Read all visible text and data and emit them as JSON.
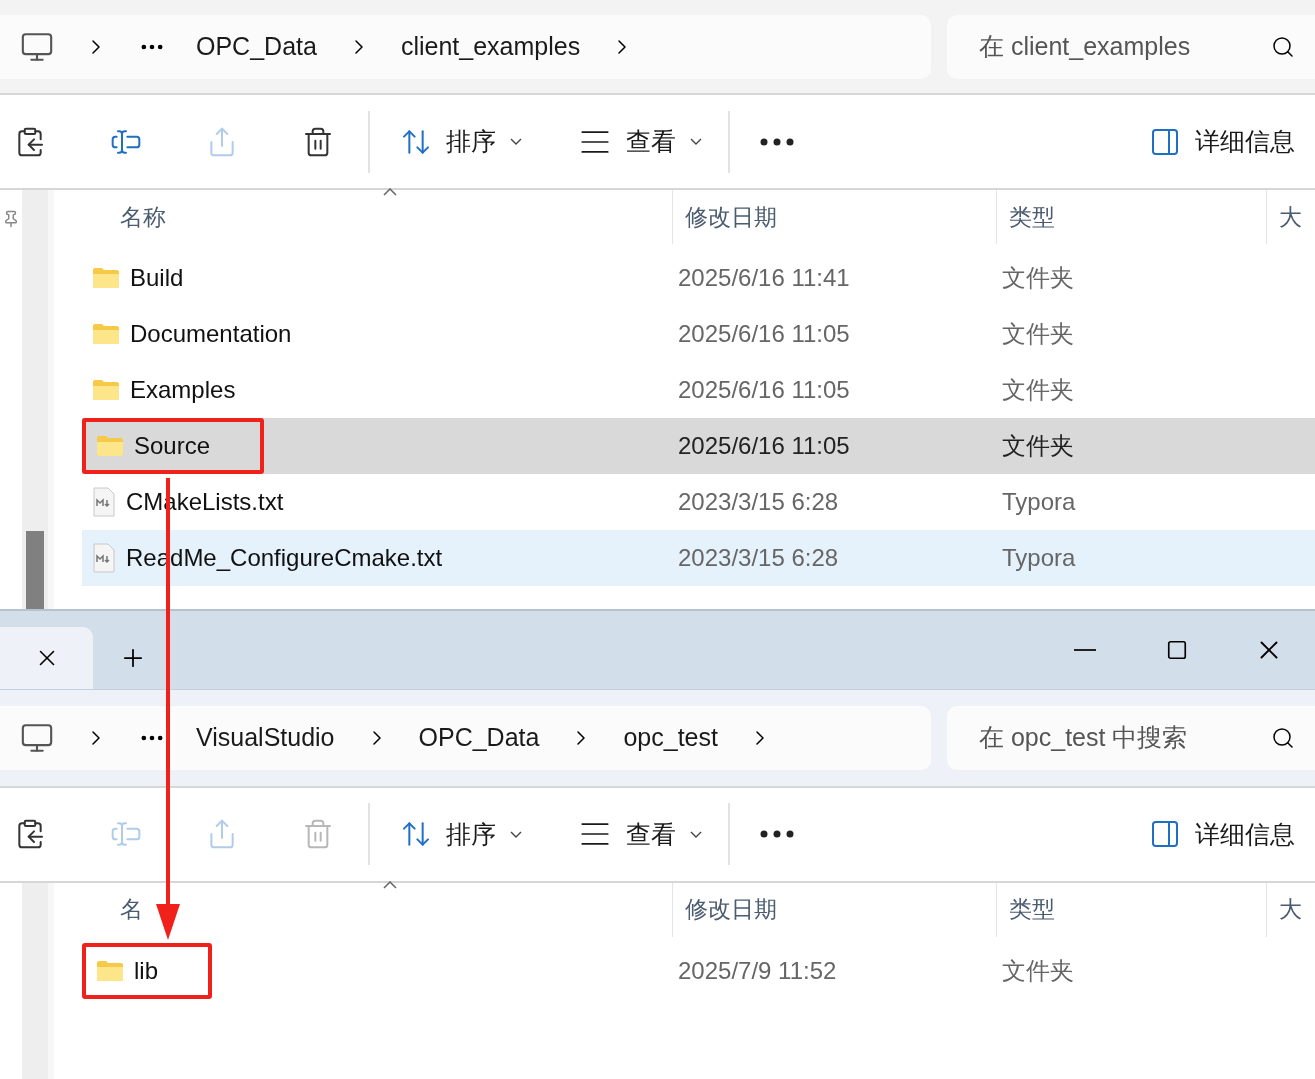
{
  "windows": [
    {
      "kind": "plain",
      "breadcrumb": [
        "OPC_Data",
        "client_examples"
      ],
      "search": {
        "placeholder": "在 client_examples"
      },
      "toolbar": {
        "actions": [
          {
            "kind": "copy",
            "disabled": false
          },
          {
            "kind": "rename",
            "disabled": false
          },
          {
            "kind": "share",
            "disabled": true
          },
          {
            "kind": "delete",
            "disabled": false
          }
        ],
        "sort": "排序",
        "view": "查看",
        "details": "详细信息"
      },
      "columns": [
        "名称",
        "修改日期",
        "类型",
        "大"
      ],
      "rows": [
        {
          "kind": "folder",
          "name": "Build",
          "date": "2025/6/16 11:41",
          "type": "文件夹",
          "selected": false,
          "hovered": false,
          "marked": false
        },
        {
          "kind": "folder",
          "name": "Documentation",
          "date": "2025/6/16 11:05",
          "type": "文件夹",
          "selected": false,
          "hovered": false,
          "marked": false
        },
        {
          "kind": "folder",
          "name": "Examples",
          "date": "2025/6/16 11:05",
          "type": "文件夹",
          "selected": false,
          "hovered": false,
          "marked": false
        },
        {
          "kind": "folder",
          "name": "Source",
          "date": "2025/6/16 11:05",
          "type": "文件夹",
          "selected": true,
          "hovered": false,
          "marked": true
        },
        {
          "kind": "markdown",
          "name": "CMakeLists.txt",
          "date": "2023/3/15 6:28",
          "type": "Typora",
          "selected": false,
          "hovered": false,
          "marked": false
        },
        {
          "kind": "markdown",
          "name": "ReadMe_ConfigureCmake.txt",
          "date": "2023/3/15 6:28",
          "type": "Typora",
          "selected": false,
          "hovered": true,
          "marked": false
        }
      ]
    },
    {
      "kind": "tabbed",
      "breadcrumb": [
        "VisualStudio",
        "OPC_Data",
        "opc_test"
      ],
      "search": {
        "placeholder": "在 opc_test 中搜索"
      },
      "toolbar": {
        "actions": [
          {
            "kind": "copy",
            "disabled": false
          },
          {
            "kind": "rename",
            "disabled": true
          },
          {
            "kind": "share",
            "disabled": true
          },
          {
            "kind": "delete",
            "disabled": true
          }
        ],
        "sort": "排序",
        "view": "查看",
        "details": "详细信息"
      },
      "columns": [
        "名",
        "修改日期",
        "类型",
        "大"
      ],
      "rows": [
        {
          "kind": "folder",
          "name": "lib",
          "date": "2025/7/9 11:52",
          "type": "文件夹",
          "selected": false,
          "hovered": false,
          "marked": true
        }
      ]
    }
  ],
  "annotation_arrow": true
}
